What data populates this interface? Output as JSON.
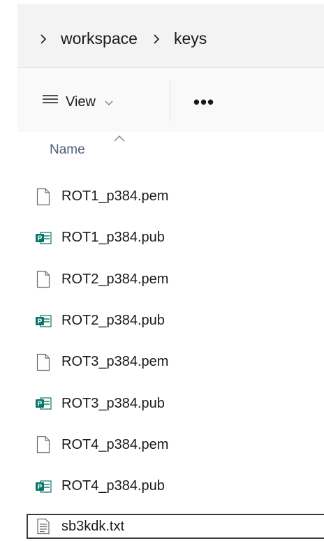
{
  "breadcrumb": {
    "items": [
      "workspace",
      "keys"
    ]
  },
  "toolbar": {
    "view_label": "View",
    "more_label": "•••"
  },
  "column_header": {
    "name_label": "Name"
  },
  "files": [
    {
      "name": "ROT1_p384.pem",
      "icon": "blank-file-icon"
    },
    {
      "name": "ROT1_p384.pub",
      "icon": "publisher-file-icon"
    },
    {
      "name": "ROT2_p384.pem",
      "icon": "blank-file-icon"
    },
    {
      "name": "ROT2_p384.pub",
      "icon": "publisher-file-icon"
    },
    {
      "name": "ROT3_p384.pem",
      "icon": "blank-file-icon"
    },
    {
      "name": "ROT3_p384.pub",
      "icon": "publisher-file-icon"
    },
    {
      "name": "ROT4_p384.pem",
      "icon": "blank-file-icon"
    },
    {
      "name": "ROT4_p384.pub",
      "icon": "publisher-file-icon"
    },
    {
      "name": "sb3kdk.txt",
      "icon": "text-file-icon",
      "selected": true
    }
  ],
  "colors": {
    "address_bg": "#f3f3f3",
    "toolbar_bg": "#f9f9f9",
    "publisher_teal": "#077568",
    "header_text": "#4a5f7a"
  }
}
